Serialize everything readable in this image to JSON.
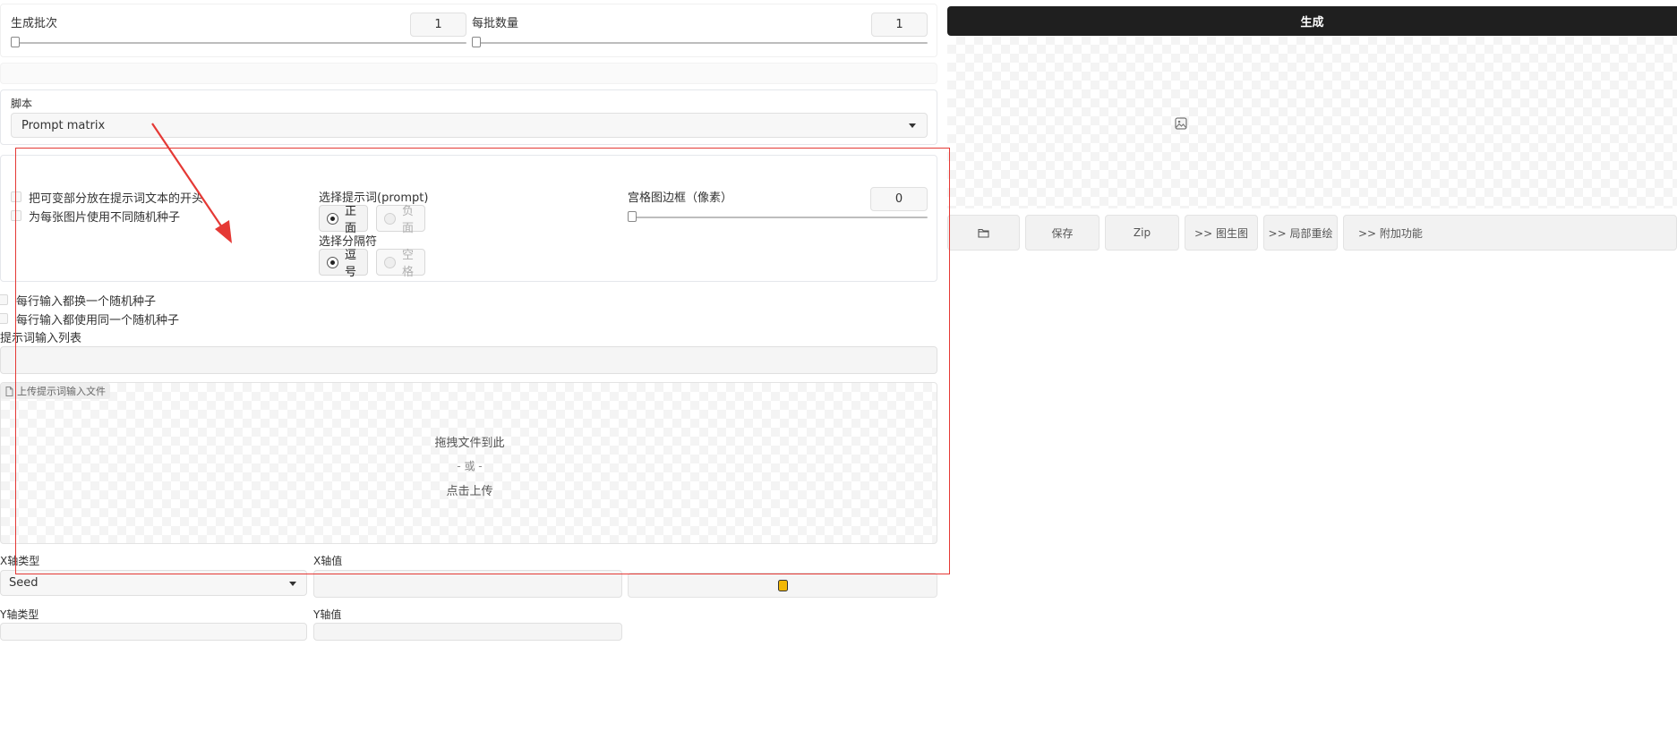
{
  "batch": {
    "count_label": "生成批次",
    "count_value": "1",
    "count_level": 0,
    "size_label": "每批数量",
    "size_value": "1",
    "size_level": 0
  },
  "script": {
    "label": "脚本",
    "selected": "Prompt matrix"
  },
  "prompt_matrix": {
    "option_variable_start": "把可变部分放在提示词文本的开头",
    "option_diff_seed": "为每张图片使用不同随机种子",
    "prompt_select_label": "选择提示词(prompt)",
    "prompt_positive": "正面",
    "prompt_negative": "负面",
    "separator_label": "选择分隔符",
    "separator_comma": "逗号",
    "separator_space": "空格",
    "grid_margin_label": "宫格图边框（像素）",
    "grid_margin_value": "0",
    "grid_margin_level": 0
  },
  "prompts_list": {
    "option_iterate_seed": "每行输入都换一个随机种子",
    "option_same_seed": "每行输入都使用同一个随机种子",
    "list_label": "提示词输入列表",
    "upload_badge": "上传提示词输入文件",
    "drop_text": "拖拽文件到此",
    "or_text": "- 或 -",
    "click_text": "点击上传"
  },
  "xyz": {
    "x_type_label": "X轴类型",
    "x_type_value": "Seed",
    "x_values_label": "X轴值",
    "y_type_label": "Y轴类型",
    "y_values_label": "Y轴值"
  },
  "output": {
    "generate_label": "生成",
    "buttons": [
      "保存",
      "Zip",
      ">> 图生图",
      ">> 局部重绘",
      ">> 附加功能"
    ]
  },
  "colors": {
    "generate_bg": "#1f1f1f",
    "annotation_red": "#e53935",
    "dice_yellow": "#f2b705"
  },
  "icons": {
    "folder": "folder-icon",
    "image_placeholder": "image-placeholder-icon",
    "file": "file-icon",
    "dice": "dice-icon",
    "dropdown": "chevron-down-icon"
  }
}
